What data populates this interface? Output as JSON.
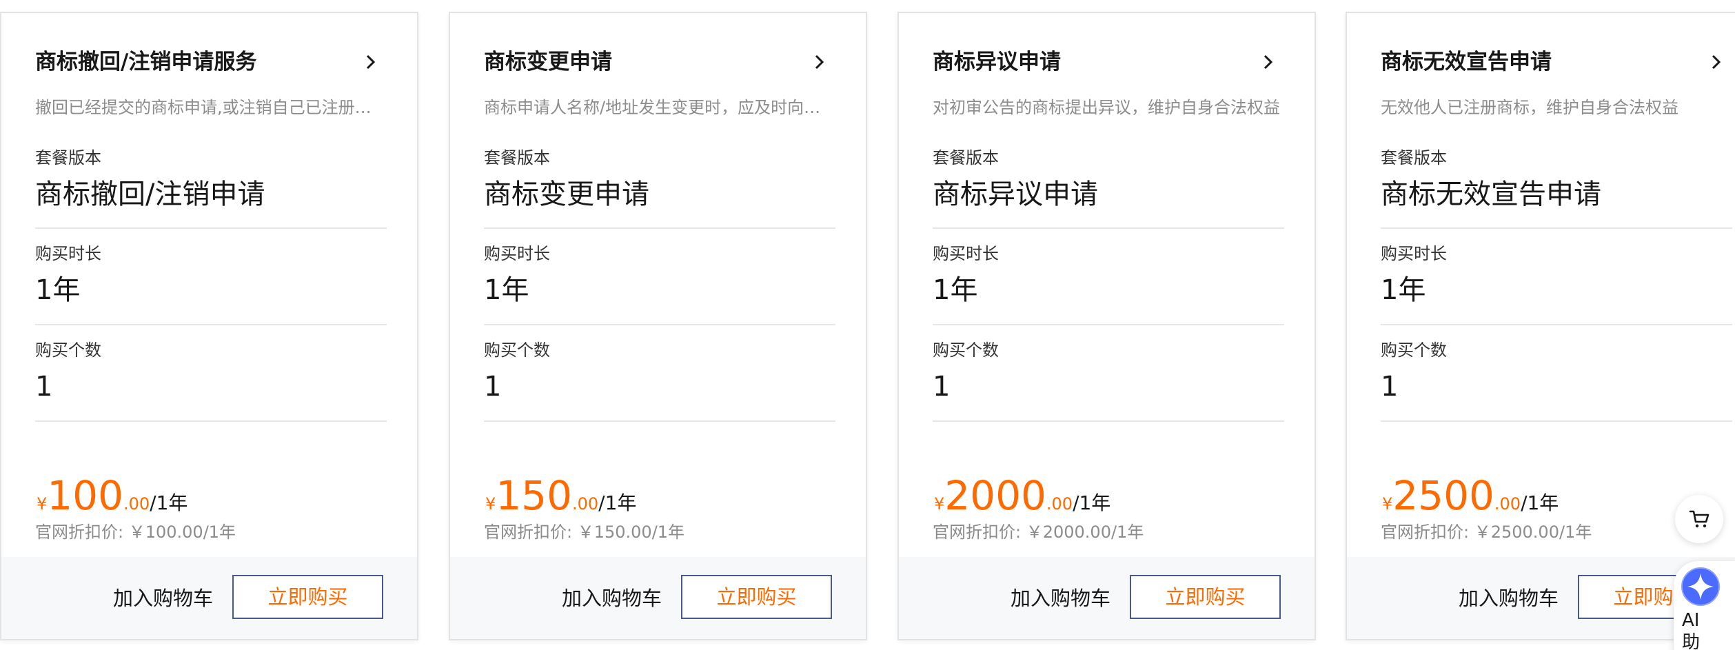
{
  "cards": [
    {
      "title": "商标撤回/注销申请服务",
      "description": "撤回已经提交的商标申请,或注销自己已注册的商标",
      "package_label": "套餐版本",
      "package_value": "商标撤回/注销申请",
      "duration_label": "购买时长",
      "duration_value": "1年",
      "quantity_label": "购买个数",
      "quantity_value": "1",
      "price_currency": "¥",
      "price_integer": "100",
      "price_decimal": ".00",
      "price_unit": "/1年",
      "reference_price": "官网折扣价: ￥100.00/1年",
      "cart_label": "加入购物车",
      "buy_label": "立即购买"
    },
    {
      "title": "商标变更申请",
      "description": "商标申请人名称/地址发生变更时，应及时向商标局提交变更申请",
      "package_label": "套餐版本",
      "package_value": "商标变更申请",
      "duration_label": "购买时长",
      "duration_value": "1年",
      "quantity_label": "购买个数",
      "quantity_value": "1",
      "price_currency": "¥",
      "price_integer": "150",
      "price_decimal": ".00",
      "price_unit": "/1年",
      "reference_price": "官网折扣价: ￥150.00/1年",
      "cart_label": "加入购物车",
      "buy_label": "立即购买"
    },
    {
      "title": "商标异议申请",
      "description": "对初审公告的商标提出异议，维护自身合法权益",
      "package_label": "套餐版本",
      "package_value": "商标异议申请",
      "duration_label": "购买时长",
      "duration_value": "1年",
      "quantity_label": "购买个数",
      "quantity_value": "1",
      "price_currency": "¥",
      "price_integer": "2000",
      "price_decimal": ".00",
      "price_unit": "/1年",
      "reference_price": "官网折扣价: ￥2000.00/1年",
      "cart_label": "加入购物车",
      "buy_label": "立即购买"
    },
    {
      "title": "商标无效宣告申请",
      "description": "无效他人已注册商标，维护自身合法权益",
      "package_label": "套餐版本",
      "package_value": "商标无效宣告申请",
      "duration_label": "购买时长",
      "duration_value": "1年",
      "quantity_label": "购买个数",
      "quantity_value": "1",
      "price_currency": "¥",
      "price_integer": "2500",
      "price_decimal": ".00",
      "price_unit": "/1年",
      "reference_price": "官网折扣价: ￥2500.00/1年",
      "cart_label": "加入购物车",
      "buy_label": "立即购买"
    }
  ],
  "floating": {
    "cart_icon": "shopping-cart-icon",
    "ai_icon": "sparkle-icon",
    "ai_label": "AI助"
  },
  "colors": {
    "price": "#ff6a00",
    "button_border": "#4a5a8c",
    "footer_bg": "#f7f8fa",
    "muted_text": "#8c8c8c",
    "ai_icon_fill": "#4b6bff"
  }
}
